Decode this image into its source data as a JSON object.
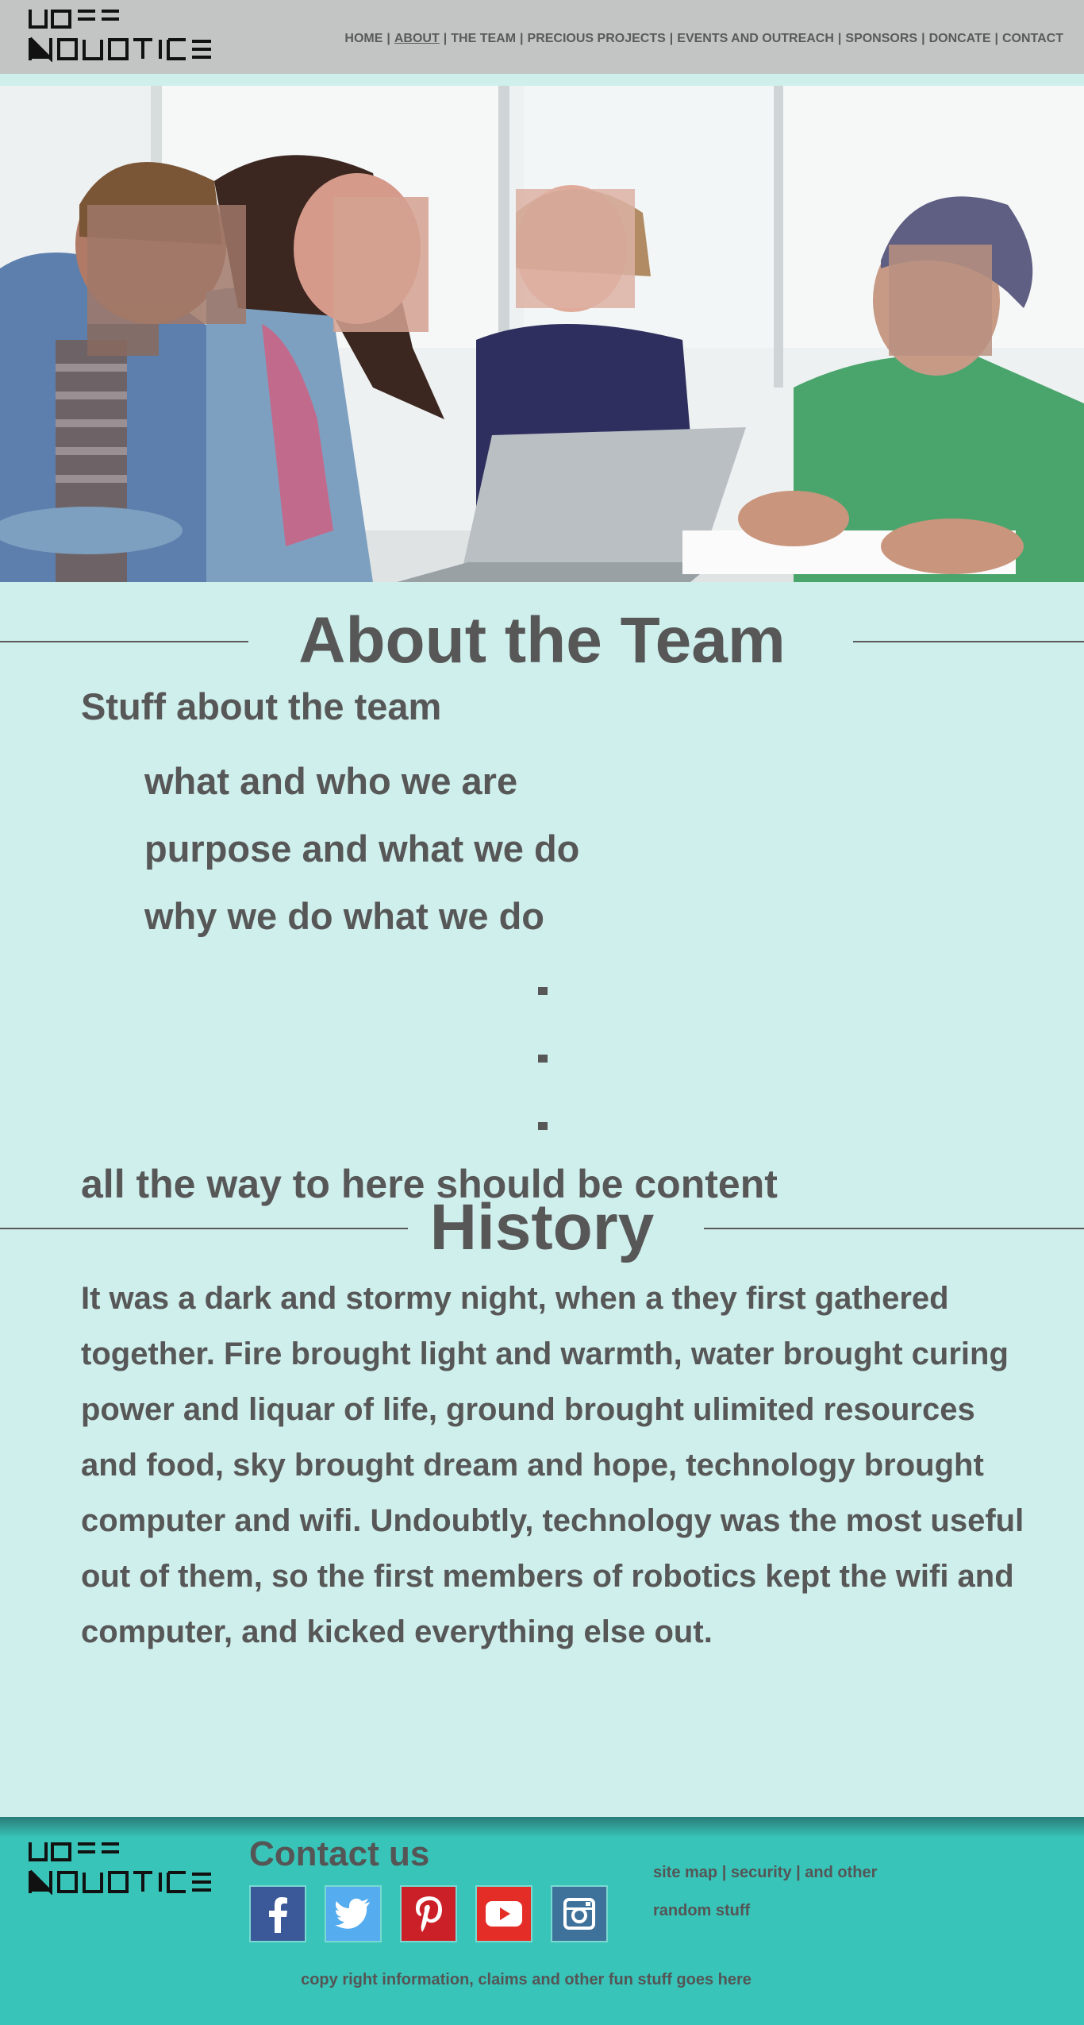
{
  "header": {
    "logo_text": "HOSS ROBOTICS",
    "nav": [
      {
        "label": "HOME",
        "active": false
      },
      {
        "label": "ABOUT",
        "active": true
      },
      {
        "label": "THE TEAM",
        "active": false
      },
      {
        "label": "PRECIOUS PROJECTS",
        "active": false
      },
      {
        "label": "EVENTS AND OUTREACH",
        "active": false
      },
      {
        "label": "SPONSORS",
        "active": false
      },
      {
        "label": "DONCATE",
        "active": false
      },
      {
        "label": "CONTACT",
        "active": false
      }
    ]
  },
  "about": {
    "heading": "About the Team",
    "subtitle": "Stuff about the team",
    "points": [
      "what and who we are",
      "purpose and what we do",
      "why we do what we do"
    ],
    "dots": [
      ".",
      ".",
      "."
    ],
    "tail": "all the way to here should be content"
  },
  "history": {
    "heading": "History",
    "text": "It was a dark and stormy night, when a they first gathered together. Fire brought light and warmth, water brought curing power and liquar of life, ground brought ulimited resources and food, sky brought dream and hope, technology brought computer and wifi. Undoubtly, technology was the most useful out of them, so the first members of robotics kept the wifi and computer, and kicked everything else out."
  },
  "footer": {
    "logo_text": "HOSS ROBOTICS",
    "contact_title": "Contact us",
    "socials": [
      "facebook-icon",
      "twitter-icon",
      "pinterest-icon",
      "youtube-icon",
      "instagram-icon"
    ],
    "links_line1": "site map | security | and other",
    "links_line2": "random stuff",
    "copyright": "copy right information, claims and other fun stuff goes here"
  },
  "colors": {
    "page_bg": "#ceefec",
    "header_bg": "#c3c5c5",
    "footer_bg": "#38c4b9",
    "text": "#575757"
  }
}
